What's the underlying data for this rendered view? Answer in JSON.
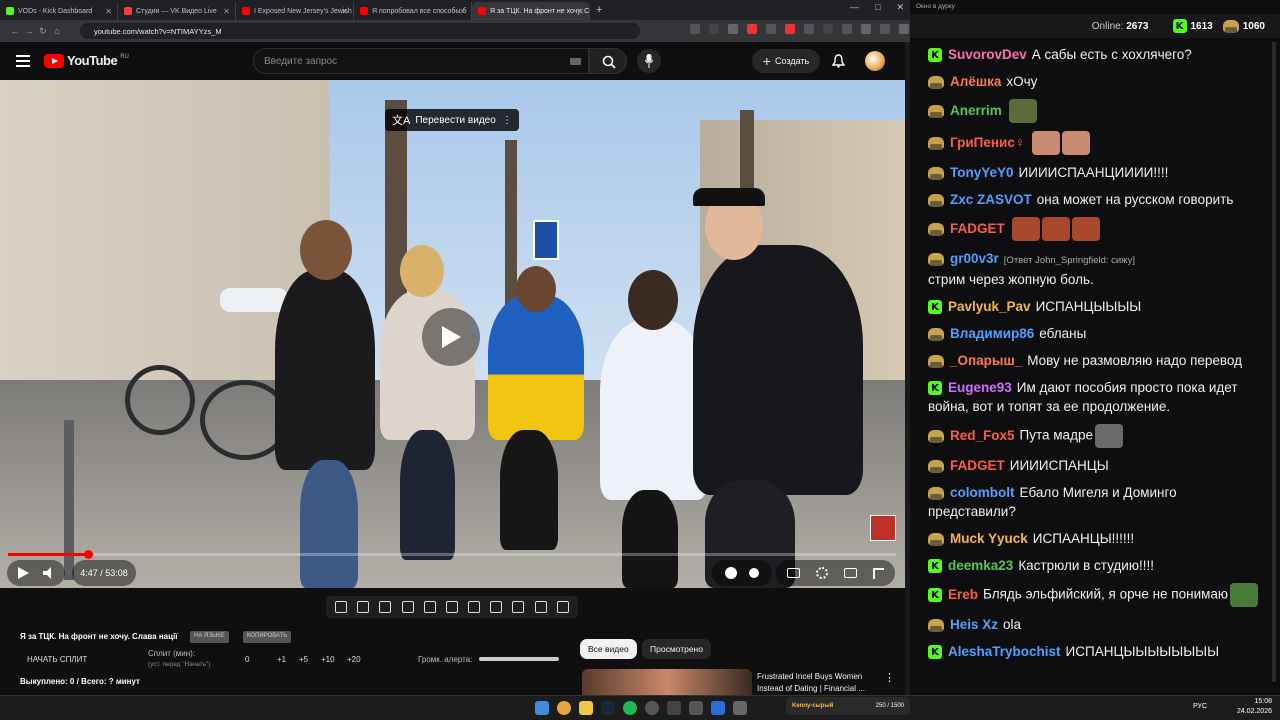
{
  "browser": {
    "tabs": [
      {
        "label": "VODs - Kick Dashboard",
        "color": "#53fc18"
      },
      {
        "label": "Студия — VK Видео Live",
        "color": "#ff3b30"
      },
      {
        "label": "I Exposed New Jersey's Jewish",
        "color": "#ff0000"
      },
      {
        "label": "Я попробовал все способы б",
        "color": "#ff0000"
      },
      {
        "label": "Я за ТЦК. На фронт не хочу. С",
        "color": "#ff0000"
      }
    ],
    "url": "youtube.com/watch?v=NTIMAYYzs_M",
    "new_tab": "+"
  },
  "youtube": {
    "logo": "YouTube",
    "region": "RU",
    "search_placeholder": "Введите запрос",
    "create_label": "Создать",
    "translate_label": "Перевести видео",
    "time": "4:47 / 53:08",
    "progress_fraction": 0.09
  },
  "below": {
    "title": "Я за ТЦК. На фронт не хочу. Слава нації",
    "badge1": "НА ЯЗЫКЕ",
    "badge2": "КОПИРОВАТЬ",
    "split_button": "НАЧАТЬ СПЛИТ",
    "split_label": "Сплит (мин):",
    "split_hint": "(уст. перед \"Начать\")",
    "split_value": "0",
    "steps": [
      "+1",
      "+5",
      "+10",
      "+20"
    ],
    "alert_label": "Громк. алерта:",
    "bought": "Выкуплено: 0 / Всего: ? минут",
    "chip_all": "Все видео",
    "chip_watched": "Просмотрено",
    "suggestion_title": "Frustrated Incel Buys Women Instead of Dating | Financial ..."
  },
  "chat": {
    "window_title": "Окно в дурку",
    "online_label": "Online:",
    "online_count": "2673",
    "kick_count": "1613",
    "other_count": "1060",
    "messages": [
      {
        "user": "SuvorovDev",
        "color": "#ff6fa8",
        "badge": "kick",
        "text": "А сабы есть с хохлячего?"
      },
      {
        "user": "Алёшка",
        "color": "#ff7a45",
        "badge": "helmet",
        "text": "хОчу"
      },
      {
        "user": "Anerrim",
        "color": "#53c653",
        "badge": "helmet",
        "text": "",
        "emotes": [
          "#5d6b3a"
        ]
      },
      {
        "user": "ГриПенис♀",
        "color": "#ff5a4a",
        "badge": "helmet",
        "text": "",
        "emotes": [
          "#c98b6f",
          "#c98b6f"
        ]
      },
      {
        "user": "TonyYeY0",
        "color": "#4ea1ff",
        "badge": "helmet",
        "text": "ИИИИСПААНЦИИИИ!!!!"
      },
      {
        "user": "Zxc ZASVOT",
        "color": "#4ea1ff",
        "badge": "helmet",
        "text": "она может на русском говорить"
      },
      {
        "user": "FADGET",
        "color": "#ff5a4a",
        "badge": "helmet",
        "text": "",
        "emotes": [
          "#a8492e",
          "#a8492e",
          "#a8492e"
        ]
      },
      {
        "user": "gr00v3r",
        "color": "#4ea1ff",
        "badge": "helmet",
        "reply": "[Ответ John_Springfield: сижу]",
        "text": "стрим через жопную боль."
      },
      {
        "user": "Pavlyuk_Pav",
        "color": "#f7b83a",
        "badge": "kick",
        "text": "ИСПАНЦЫЫЫЫ"
      },
      {
        "user": "Владимир86",
        "color": "#4ea1ff",
        "badge": "helmet",
        "text": "ебланы"
      },
      {
        "user": "_Опарыш_",
        "color": "#ff7a45",
        "badge": "helmet",
        "text": "Мову не размовляю надо перевод"
      },
      {
        "user": "Eugene93",
        "color": "#d16cff",
        "badge": "kick",
        "text": "Им дают пособия просто пока идет война, вот и топят за ее продолжение."
      },
      {
        "user": "Red_Fox5",
        "color": "#ff5a4a",
        "badge": "helmet",
        "text": "Пута мадре",
        "emotes": [
          "#6b6b6b"
        ]
      },
      {
        "user": "FADGET",
        "color": "#ff5a4a",
        "badge": "helmet",
        "text": "ИИИИСПАНЦЫ"
      },
      {
        "user": "colombolt",
        "color": "#4ea1ff",
        "badge": "helmet",
        "text": "Ебало Мигеля и Доминго представили?"
      },
      {
        "user": "Muck Yyuck",
        "color": "#f7b83a",
        "badge": "helmet",
        "text": "ИСПААНЦЫ!!!!!!"
      },
      {
        "user": "deemka23",
        "color": "#53c653",
        "badge": "kick",
        "text": "Кастрюли в студию!!!!"
      },
      {
        "user": "Ereb",
        "color": "#ff5a4a",
        "badge": "kick",
        "text": "Блядь эльфийский, я орче не понимаю",
        "emotes": [
          "#4a7a3a"
        ]
      },
      {
        "user": "Heis Xz",
        "color": "#4ea1ff",
        "badge": "helmet",
        "text": "ola"
      },
      {
        "user": "AleshaTrybochist",
        "color": "#4ea1ff",
        "badge": "kick",
        "text": "ИСПАНЦЫЫЫЫЫЫЫЫ"
      }
    ]
  },
  "taskbar": {
    "game_label": "Kenny-сырый",
    "game_count": "250 / 1500",
    "lang": "РУС",
    "time": "15:08",
    "date": "24.02.2026"
  }
}
